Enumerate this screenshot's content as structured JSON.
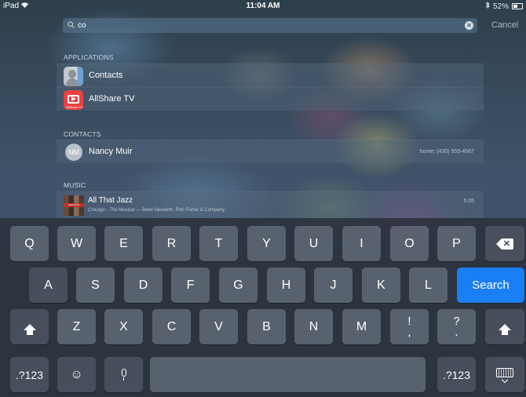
{
  "status_bar": {
    "device": "iPad",
    "time": "11:04 AM",
    "battery": "52%",
    "battery_level": 0.52
  },
  "search": {
    "query": "co",
    "cancel_label": "Cancel"
  },
  "results": {
    "applications": {
      "header": "APPLICATIONS",
      "items": [
        {
          "label": "Contacts",
          "icon": "contacts-app-icon"
        },
        {
          "label": "AllShare TV",
          "icon": "allshare-tv-app-icon",
          "icon_caption": "AllShare TV"
        }
      ]
    },
    "contacts": {
      "header": "CONTACTS",
      "items": [
        {
          "initials": "NM",
          "name": "Nancy Muir",
          "phone": "home: (430) 555-4567"
        }
      ]
    },
    "music": {
      "header": "MUSIC",
      "items": [
        {
          "title": "All That Jazz",
          "subtitle": "Chicago - The Musical  —  Bebe Neuwirth, Rob Fisher & Company",
          "duration": "5:05",
          "album_caption": "CHICAGO"
        }
      ]
    }
  },
  "keyboard": {
    "row1": [
      "Q",
      "W",
      "E",
      "R",
      "T",
      "Y",
      "U",
      "I",
      "O",
      "P"
    ],
    "row2": [
      "A",
      "S",
      "D",
      "F",
      "G",
      "H",
      "J",
      "K",
      "L"
    ],
    "row3": [
      "Z",
      "X",
      "C",
      "V",
      "B",
      "N",
      "M"
    ],
    "punct1": {
      "top": "!",
      "bottom": ","
    },
    "punct2": {
      "top": "?",
      "bottom": "."
    },
    "search_label": "Search",
    "numbers_label": ".?123",
    "emoji_label": "☺",
    "accent_color": "#1a7ff5"
  }
}
